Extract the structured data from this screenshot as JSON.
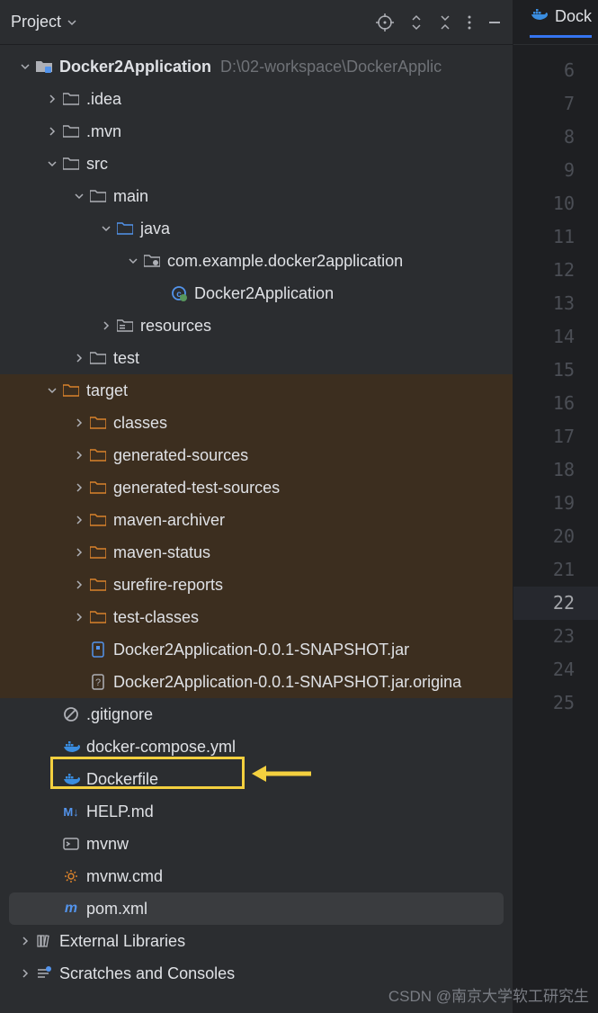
{
  "panel": {
    "title": "Project"
  },
  "editor": {
    "tab_label": "Dock",
    "line_numbers": [
      6,
      7,
      8,
      9,
      10,
      11,
      12,
      13,
      14,
      15,
      16,
      17,
      18,
      19,
      20,
      21,
      22,
      23,
      24,
      25
    ],
    "current_line": 22
  },
  "tree": {
    "root": {
      "name": "Docker2Application",
      "path": "D:\\02-workspace\\DockerApplic"
    },
    "nodes": {
      "idea": ".idea",
      "mvn": ".mvn",
      "src": "src",
      "main": "main",
      "java": "java",
      "pkg": "com.example.docker2application",
      "app_class": "Docker2Application",
      "resources": "resources",
      "test": "test",
      "target": "target",
      "classes": "classes",
      "gen_sources": "generated-sources",
      "gen_test_sources": "generated-test-sources",
      "maven_archiver": "maven-archiver",
      "maven_status": "maven-status",
      "surefire": "surefire-reports",
      "test_classes": "test-classes",
      "jar": "Docker2Application-0.0.1-SNAPSHOT.jar",
      "jar_orig": "Docker2Application-0.0.1-SNAPSHOT.jar.origina",
      "gitignore": ".gitignore",
      "docker_compose": "docker-compose.yml",
      "dockerfile": "Dockerfile",
      "help_md": "HELP.md",
      "mvnw": "mvnw",
      "mvnw_cmd": "mvnw.cmd",
      "pom": "pom.xml",
      "ext_libs": "External Libraries",
      "scratches": "Scratches and Consoles"
    }
  },
  "watermark": "CSDN @南京大学软工研究生"
}
